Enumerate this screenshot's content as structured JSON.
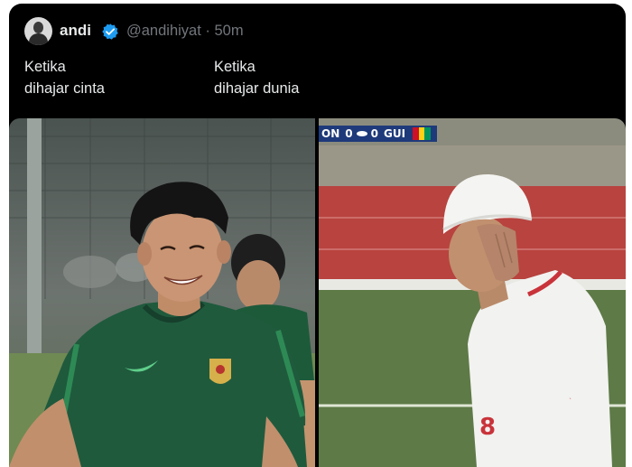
{
  "post": {
    "author_name": "andi",
    "handle_time": "@andihiyat · 50m",
    "caption_left_line1": "Ketika",
    "caption_left_line2": "dihajar cinta",
    "caption_right_line1": "Ketika",
    "caption_right_line2": "dihajar dunia"
  },
  "scoreboard": {
    "team_left": "ON",
    "score_left": "0",
    "score_right": "0",
    "team_right": "GUI"
  },
  "colors": {
    "background": "#000000",
    "text_primary": "#e7e9ea",
    "text_secondary": "#71767b",
    "verified_blue": "#1d9bf0",
    "jersey_green": "#1f5a3d",
    "track_red": "#b8433f"
  },
  "icons": [
    "verified-badge-icon",
    "avatar"
  ]
}
